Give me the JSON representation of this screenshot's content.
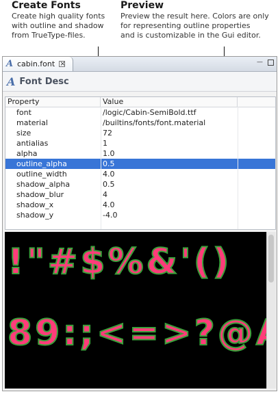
{
  "callouts": {
    "left": {
      "title": "Create Fonts",
      "body": "Create high quality fonts\nwith outline and shadow\nfrom TrueType-files."
    },
    "right": {
      "title": "Preview",
      "body": "Preview the result here. Colors are only\nfor representing outline properties\nand is customizable in the Gui editor."
    }
  },
  "editor": {
    "tab": {
      "label": "cabin.font",
      "icon": "font-file-icon"
    },
    "title": "Font Desc",
    "columns": [
      "Property",
      "Value"
    ],
    "rows": [
      {
        "property": "font",
        "value": "/logic/Cabin-SemiBold.ttf"
      },
      {
        "property": "material",
        "value": "/builtins/fonts/font.material"
      },
      {
        "property": "size",
        "value": "72"
      },
      {
        "property": "antialias",
        "value": "1"
      },
      {
        "property": "alpha",
        "value": "1.0"
      },
      {
        "property": "outline_alpha",
        "value": "0.5",
        "selected": true
      },
      {
        "property": "outline_width",
        "value": "4.0"
      },
      {
        "property": "shadow_alpha",
        "value": "0.5"
      },
      {
        "property": "shadow_blur",
        "value": "4"
      },
      {
        "property": "shadow_x",
        "value": "4.0"
      },
      {
        "property": "shadow_y",
        "value": "-4.0"
      }
    ]
  },
  "preview": {
    "line1": "!\"#$%&'()",
    "line2": "89:;<=>?@A",
    "fill_color": "#ff3c7a",
    "outline_color": "#3aa03a",
    "background_color": "#000000"
  },
  "colors": {
    "selection": "#3875d7",
    "icon_accent": "#4a6ea9"
  }
}
